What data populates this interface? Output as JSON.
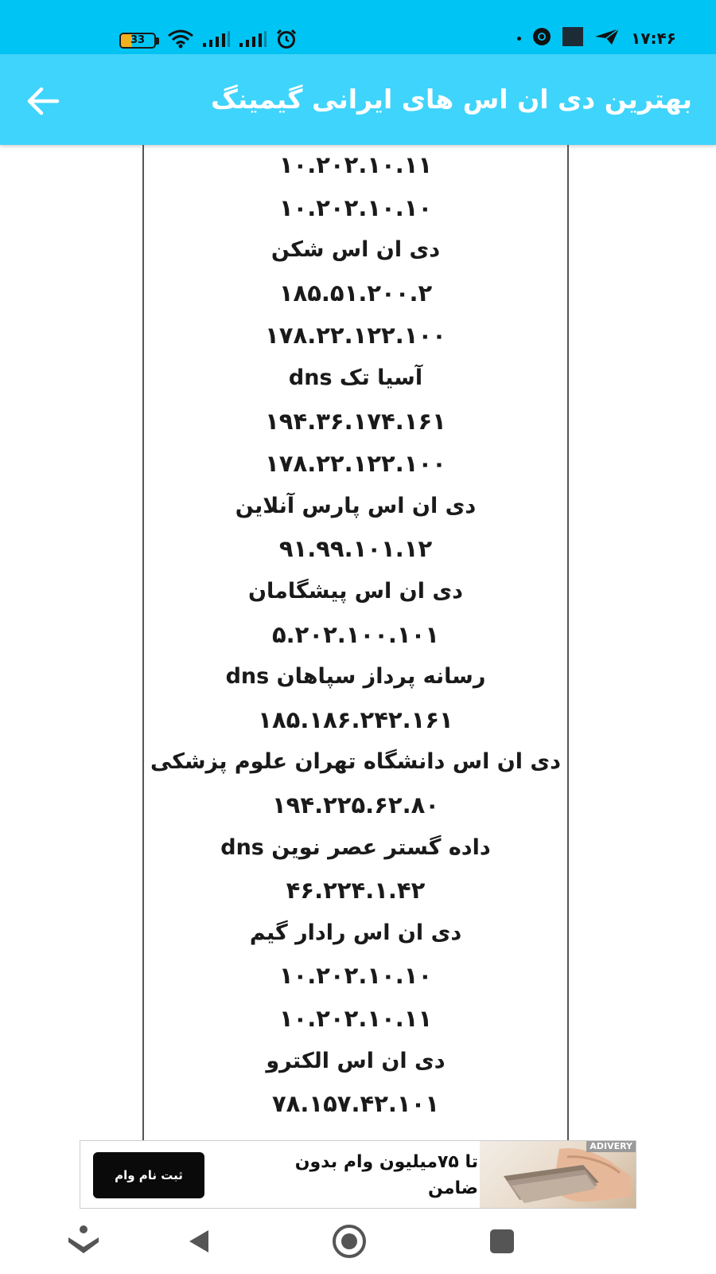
{
  "status_bar": {
    "battery_level": "33",
    "battery_fraction": 0.33,
    "time": "۱۷:۴۶",
    "icons": [
      "wifi-icon",
      "signal-icon",
      "signal-icon",
      "alarm-icon",
      "chrome-icon",
      "app-icon",
      "telegram-icon"
    ]
  },
  "toolbar": {
    "title": "بهترین دی ان اس های ایرانی گیمینگ",
    "back_icon": "arrow-left-icon"
  },
  "dns_list": [
    "۱۰.۲۰۲.۱۰.۱۱",
    "۱۰.۲۰۲.۱۰.۱۰",
    "دی ان اس شکن",
    "۱۸۵.۵۱.۲۰۰.۲",
    "۱۷۸.۲۲.۱۲۲.۱۰۰",
    "آسیا تک dns",
    "۱۹۴.۳۶.۱۷۴.۱۶۱",
    "۱۷۸.۲۲.۱۲۲.۱۰۰",
    "دی ان اس پارس آنلاین",
    "۹۱.۹۹.۱۰۱.۱۲",
    "دی ان اس پیشگامان",
    "۵.۲۰۲.۱۰۰.۱۰۱",
    "رسانه پرداز سپاهان dns",
    "۱۸۵.۱۸۶.۲۴۲.۱۶۱",
    "دی ان اس دانشگاه تهران علوم پزشکی",
    "۱۹۴.۲۲۵.۶۲.۸۰",
    "داده گستر عصر نوین dns",
    "۴۶.۲۲۴.۱.۴۲",
    "دی ان اس رادار گیم",
    "۱۰.۲۰۲.۱۰.۱۰",
    "۱۰.۲۰۲.۱۰.۱۱",
    "دی ان اس الکترو",
    "۷۸.۱۵۷.۴۲.۱۰۱"
  ],
  "ad": {
    "button_label": "ثبت نام وام",
    "text": "تا ۷۵میلیون وام بدون ضامن",
    "tag": "ADIVERY"
  },
  "nav": {
    "items": [
      "accessibility-icon",
      "back-triangle-icon",
      "home-circle-icon",
      "recents-square-icon"
    ]
  },
  "colors": {
    "status_bar": "#00c4f3",
    "toolbar": "#3fd4fb",
    "text": "#1a1a1a"
  }
}
